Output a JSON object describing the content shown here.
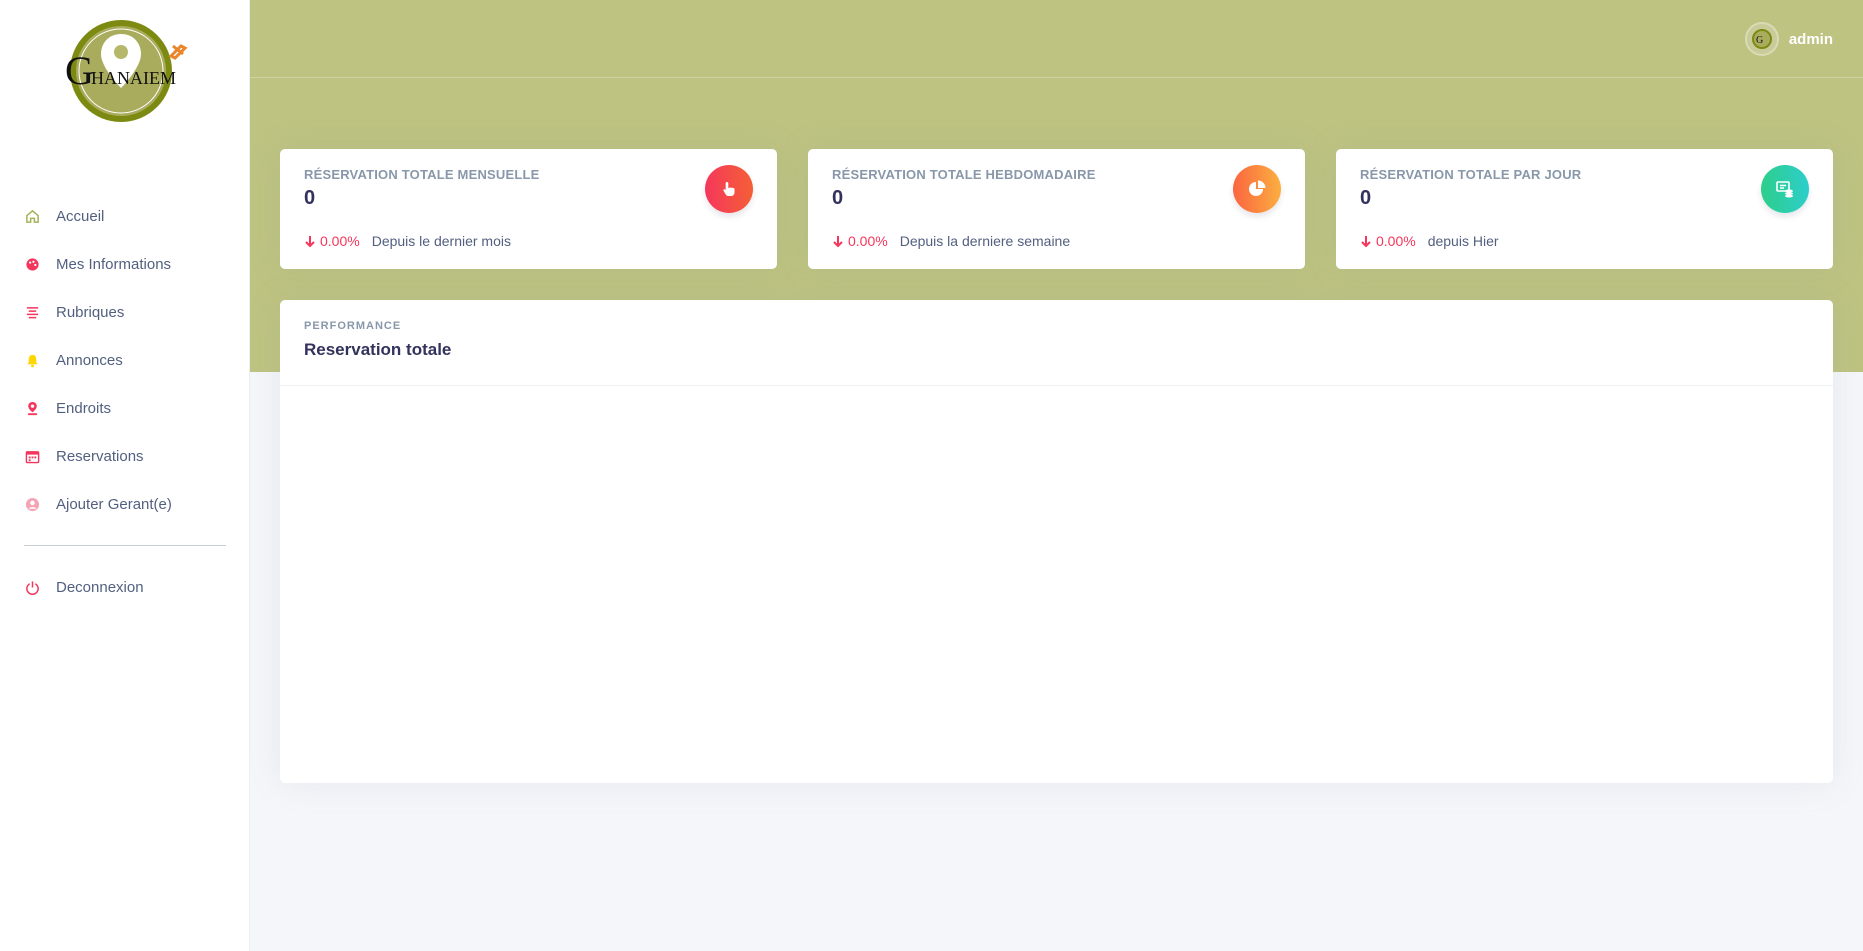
{
  "brand": {
    "logo_text": "GHANAIEM"
  },
  "sidebar": {
    "items": [
      {
        "label": "Accueil",
        "icon": "home-icon",
        "color": "#a5b25a"
      },
      {
        "label": "Mes Informations",
        "icon": "palette-icon",
        "color": "#f5365c"
      },
      {
        "label": "Rubriques",
        "icon": "align-center-icon",
        "color": "#f5365c"
      },
      {
        "label": "Annonces",
        "icon": "bell-icon",
        "color": "#ffd600"
      },
      {
        "label": "Endroits",
        "icon": "map-pin-icon",
        "color": "#f5365c"
      },
      {
        "label": "Reservations",
        "icon": "calendar-icon",
        "color": "#f5365c"
      },
      {
        "label": "Ajouter Gerant(e)",
        "icon": "user-circle-icon",
        "color": "#f3a4b5"
      }
    ],
    "logout": {
      "label": "Deconnexion",
      "icon": "power-icon",
      "color": "#f5365c"
    }
  },
  "header": {
    "user_name": "admin"
  },
  "cards": [
    {
      "title": "Réservation totale mensuelle",
      "value": "0",
      "percent": "0.00%",
      "since": "Depuis le dernier mois",
      "icon": "hand-pointer-icon"
    },
    {
      "title": "Réservation totale hebdomadaire",
      "value": "0",
      "percent": "0.00%",
      "since": "Depuis la derniere semaine",
      "icon": "pie-chart-icon"
    },
    {
      "title": "Réservation totale par jour",
      "value": "0",
      "percent": "0.00%",
      "since": "depuis Hier",
      "icon": "money-coins-icon"
    }
  ],
  "performance": {
    "eyebrow": "Performance",
    "title": "Reservation totale"
  },
  "colors": {
    "header": "#bec381",
    "danger": "#f5365c",
    "warning": "#fb6340",
    "success": "#2dce89"
  }
}
